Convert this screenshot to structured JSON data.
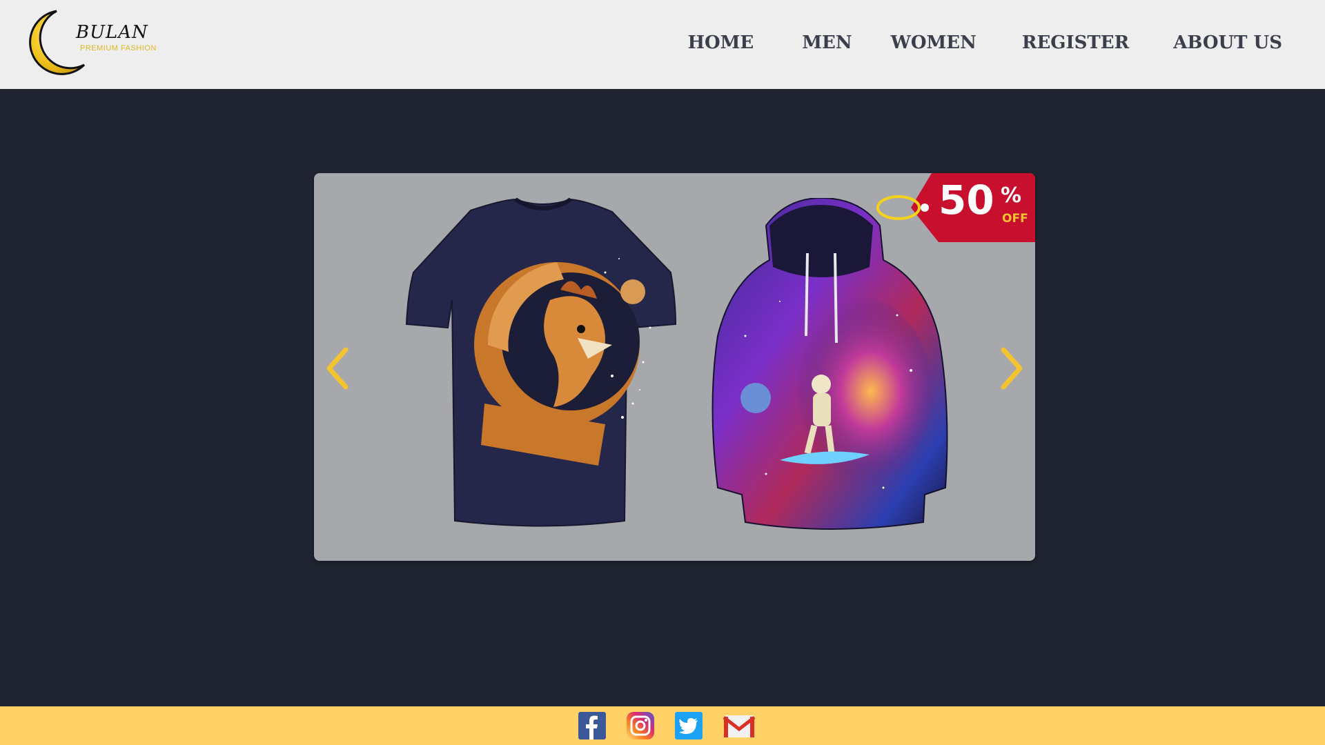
{
  "brand": {
    "name": "BULAN",
    "tagline": "PREMIUM FASHION"
  },
  "nav": {
    "items": [
      {
        "label": "HOME"
      },
      {
        "label": "MEN"
      },
      {
        "label": "WOMEN"
      },
      {
        "label": "REGISTER"
      },
      {
        "label": "ABOUT US"
      }
    ]
  },
  "carousel": {
    "badge": {
      "percent": "50",
      "sign": "%",
      "off": "OFF"
    },
    "products": [
      {
        "name": "astronaut-rooster-tshirt"
      },
      {
        "name": "galaxy-surfer-hoodie"
      }
    ],
    "prev_icon": "chevron-left-icon",
    "next_icon": "chevron-right-icon"
  },
  "footer": {
    "social": [
      "facebook-icon",
      "instagram-icon",
      "twitter-icon",
      "gmail-icon"
    ]
  },
  "colors": {
    "header_bg": "#eeeeee",
    "page_bg": "#1f2430",
    "footer_bg": "#ffd166",
    "accent": "#f4c430",
    "badge_red": "#c8102e"
  }
}
